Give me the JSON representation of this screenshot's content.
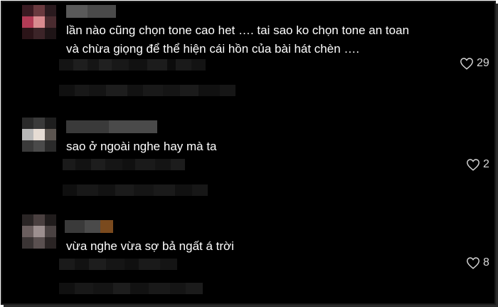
{
  "comments": [
    {
      "text": "lần nào cũng chọn tone cao het …. tai sao ko chọn tone an toan và chừa giọng để thể hiện cái hồn của bài hát chèn ….",
      "likes": "29"
    },
    {
      "text": "sao ở ngoài nghe hay mà ta",
      "likes": "2"
    },
    {
      "text": "vừa nghe vừa sợ bả ngất á trời",
      "likes": "8"
    }
  ],
  "colors": {
    "background": "#000000",
    "text": "#ffffff",
    "like": "#d9d9d9"
  },
  "icons": {
    "like": "heart-outline-icon"
  }
}
